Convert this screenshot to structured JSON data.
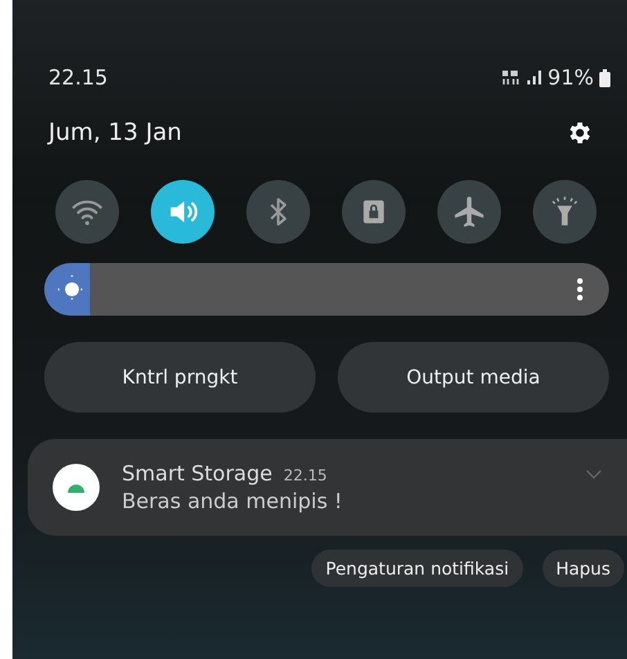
{
  "status_bar": {
    "time": "22.15",
    "battery": "91%"
  },
  "date": "Jum, 13 Jan",
  "toggles": [
    {
      "kind": "wifi",
      "on": false
    },
    {
      "kind": "sound",
      "on": true
    },
    {
      "kind": "bluetooth",
      "on": false
    },
    {
      "kind": "lock",
      "on": false
    },
    {
      "kind": "airplane",
      "on": false
    },
    {
      "kind": "flashlight",
      "on": false
    }
  ],
  "brightness": {
    "level": 0.08
  },
  "buttons": [
    "Kntrl prngkt",
    "Output media"
  ],
  "notification": {
    "app": "Smart Storage",
    "time": "22.15",
    "text": "Beras anda menipis !"
  },
  "actions": [
    "Pengaturan notifikasi",
    "Hapus"
  ]
}
